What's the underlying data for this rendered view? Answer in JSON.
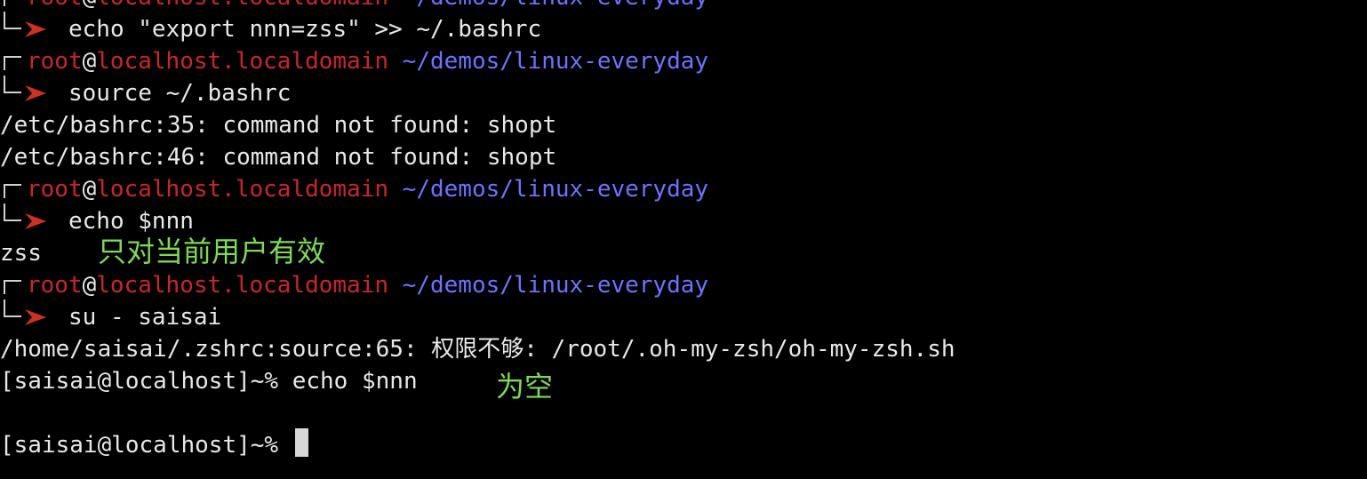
{
  "colors": {
    "background": "#000000",
    "user": "#c8262a",
    "path": "#6b73ff",
    "text": "#e8e8e8",
    "note": "#7ed957",
    "arrow": "#d0301e"
  },
  "prompt": {
    "user": "root",
    "at": "@",
    "host": "localhost.localdomain",
    "path": "~/demos/linux-everyday",
    "arrow_icon": "prompt-arrow-icon",
    "corner_icon": "prompt-corner-icon"
  },
  "lines": {
    "cmd1": "echo \"export nnn=zss\" >> ~/.bashrc",
    "cmd2": "source ~/.bashrc",
    "err1": "/etc/bashrc:35: command not found: shopt",
    "err2": "/etc/bashrc:46: command not found: shopt",
    "cmd3": "echo $nnn",
    "out_zss": "zss",
    "cmd4": "su - saisai",
    "err3": "/home/saisai/.zshrc:source:65: 权限不够: /root/.oh-my-zsh/oh-my-zsh.sh",
    "plain_prompt1": "[saisai@localhost]~% echo $nnn",
    "plain_prompt2": "[saisai@localhost]~% "
  },
  "notes": {
    "only_current_user": "只对当前用户有效",
    "empty": "为空"
  }
}
